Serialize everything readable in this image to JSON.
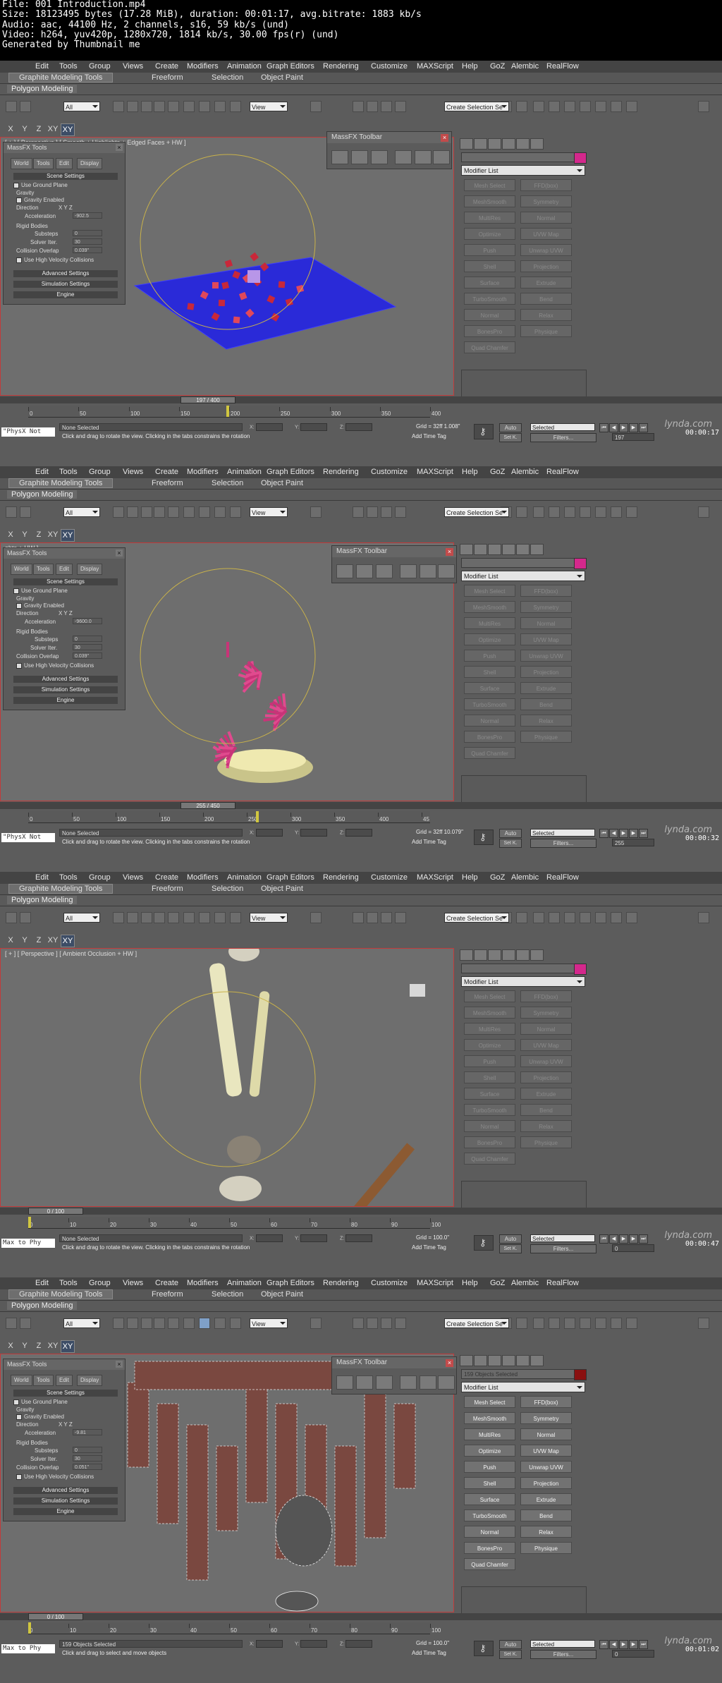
{
  "file_header": [
    "File: 001 Introduction.mp4",
    "Size: 18123495 bytes (17.28 MiB), duration: 00:01:17, avg.bitrate: 1883 kb/s",
    "Audio: aac, 44100 Hz, 2 channels, s16, 59 kb/s (und)",
    "Video: h264, yuv420p, 1280x720, 1814 kb/s, 30.00 fps(r) (und)",
    "Generated by Thumbnail me"
  ],
  "menu": [
    "Edit",
    "Tools",
    "Group",
    "Views",
    "Create",
    "Modifiers",
    "Animation",
    "Graph Editors",
    "Rendering",
    "Customize",
    "MAXScript",
    "Help",
    "GoZ",
    "Alembic",
    "RealFlow"
  ],
  "ribbon_tabs": [
    "Graphite Modeling Tools",
    "Freeform",
    "Selection",
    "Object Paint"
  ],
  "subribbon": "Polygon Modeling",
  "axis_buttons": [
    "X",
    "Y",
    "Z",
    "XY",
    "XY"
  ],
  "toolbar": {
    "filter": "All",
    "refcoord": "View",
    "named_sel": "Create Selection Se"
  },
  "massfx": {
    "title": "MassFX Tools",
    "tabs": [
      "World",
      "Tools",
      "Edit",
      "Display"
    ],
    "scene_settings": "Scene Settings",
    "use_ground": "Use Ground Plane",
    "gravity": "Gravity",
    "gravity_enabled": "Gravity Enabled",
    "direction": "Direction",
    "dir_axes": "X   Y   Z",
    "acceleration": "Acceleration",
    "rigid_bodies": "Rigid Bodies",
    "substeps": "Substeps",
    "solver_iter": "Solver Iter.",
    "collision_overlap": "Collision Overlap",
    "high_velocity": "Use High Velocity Collisions",
    "advanced": "Advanced Settings",
    "simulation": "Simulation Settings",
    "engine": "Engine"
  },
  "massfx_toolbar_title": "MassFX Toolbar",
  "modifiers": [
    [
      "Mesh Select",
      "FFD(box)"
    ],
    [
      "MeshSmooth",
      "Symmetry"
    ],
    [
      "MultiRes",
      "Normal"
    ],
    [
      "Optimize",
      "UVW Map"
    ],
    [
      "Push",
      "Unwrap UVW"
    ],
    [
      "Shell",
      "Projection"
    ],
    [
      "Surface",
      "Extrude"
    ],
    [
      "TurboSmooth",
      "Bend"
    ],
    [
      "Normal",
      "Relax"
    ],
    [
      "BonesPro",
      "Physique"
    ],
    [
      "Quad Chamfer",
      ""
    ]
  ],
  "modifier_list": "Modifier List",
  "status_common": {
    "grid_prefix": "Grid = ",
    "auto": "Auto",
    "set_key": "Set K.",
    "selected": "Selected",
    "filters": "Filters...",
    "add_time_tag": "Add Time Tag",
    "watermark": "lynda.com"
  },
  "frames": [
    {
      "viewport_label": "[ + ] [ Perspective ] [ Smooth + Highlights + Edged Faces + HW ]",
      "slider": "197 / 400",
      "ruler_labels": [
        "0",
        "50",
        "100",
        "150",
        "200",
        "250",
        "300",
        "350",
        "400"
      ],
      "listener": "\"PhysX Not",
      "selection": "None Selected",
      "prompt": "Click and drag to rotate the view.  Clicking in the tabs constrains the rotation",
      "grid": "32ff 1.008\"",
      "frame_field": "197",
      "acceleration": "-902.5",
      "substeps": "0",
      "solver": "30",
      "overlap": "0.039\"",
      "stamp": "00:00:17",
      "modifiers_active": false,
      "object_name": ""
    },
    {
      "viewport_label": "ghts + HW ]",
      "slider": "255 / 450",
      "ruler_labels": [
        "0",
        "50",
        "100",
        "150",
        "200",
        "250",
        "300",
        "350",
        "400",
        "45"
      ],
      "listener": "\"PhysX Not",
      "selection": "None Selected",
      "prompt": "Click and drag to rotate the view.  Clicking in the tabs constrains the rotation",
      "grid": "32ff 10.079\"",
      "frame_field": "255",
      "acceleration": "-9600.0",
      "substeps": "0",
      "solver": "30",
      "overlap": "0.039\"",
      "stamp": "00:00:32",
      "modifiers_active": false,
      "object_name": ""
    },
    {
      "viewport_label": "[ + ] [ Perspective ] [ Ambient Occlusion + HW ]",
      "slider": "0 / 100",
      "ruler_labels": [
        "0",
        "10",
        "20",
        "30",
        "40",
        "50",
        "60",
        "70",
        "80",
        "90",
        "100"
      ],
      "listener": "Max to Phy",
      "selection": "None Selected",
      "prompt": "Click and drag to rotate the view.  Clicking in the tabs constrains the rotation",
      "grid": "100.0\"",
      "frame_field": "0",
      "acceleration": "",
      "substeps": "",
      "solver": "",
      "overlap": "",
      "stamp": "00:00:47",
      "modifiers_active": false,
      "object_name": ""
    },
    {
      "viewport_label": "",
      "slider": "0 / 100",
      "ruler_labels": [
        "0",
        "10",
        "20",
        "30",
        "40",
        "50",
        "60",
        "70",
        "80",
        "90",
        "100"
      ],
      "listener": "Max to Phy",
      "selection": "159 Objects Selected",
      "prompt": "Click and drag to select and move objects",
      "grid": "100.0\"",
      "frame_field": "0",
      "acceleration": "-9.81",
      "substeps": "0",
      "solver": "30",
      "overlap": "0.051\"",
      "stamp": "00:01:02",
      "modifiers_active": true,
      "object_name": "159 Objects Selected"
    }
  ]
}
